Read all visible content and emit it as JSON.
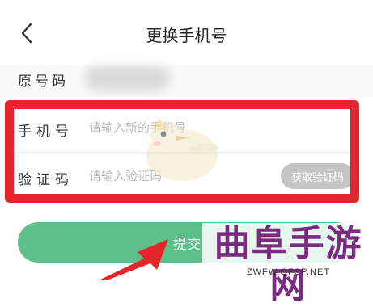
{
  "header": {
    "title": "更换手机号",
    "back_icon": "chevron-left-icon"
  },
  "original_number": {
    "label": "原号码",
    "value_blurred": true
  },
  "form": {
    "phone": {
      "label": "手机号",
      "placeholder": "请输入新的手机号",
      "value": ""
    },
    "code": {
      "label": "验证码",
      "placeholder": "请输入验证码",
      "value": "",
      "get_code_label": "获取验证码"
    },
    "highlight_color": "#e4252c"
  },
  "submit": {
    "label": "提交",
    "color": "#5dc08a"
  },
  "watermark": {
    "title": "曲阜手游网",
    "url": "ZWFW.QFSP.NET",
    "color": "#7a2a7f"
  },
  "annotation": {
    "arrow_color": "#e4252c"
  }
}
